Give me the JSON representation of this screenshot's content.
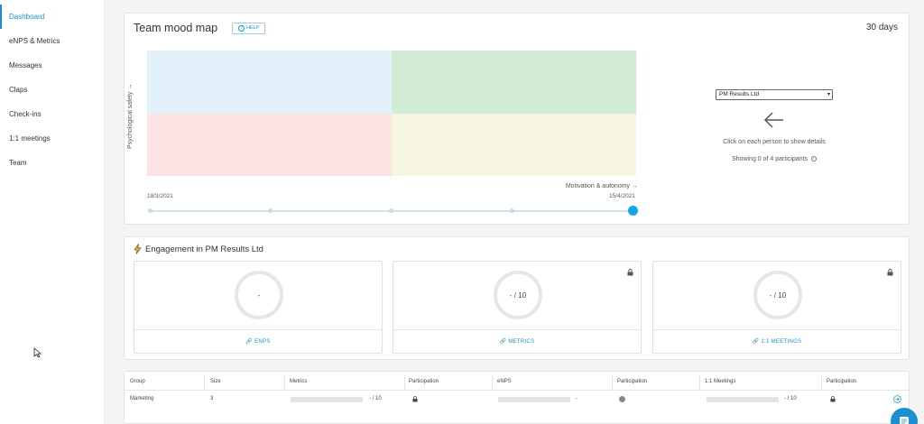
{
  "sidebar": {
    "items": [
      {
        "label": "Dashboard",
        "active": true
      },
      {
        "label": "eNPS & Metrics"
      },
      {
        "label": "Messages"
      },
      {
        "label": "Claps"
      },
      {
        "label": "Check-ins"
      },
      {
        "label": "1:1 meetings"
      },
      {
        "label": "Team"
      }
    ]
  },
  "mood_map": {
    "title": "Team mood map",
    "help_label": "HELP",
    "period": "30 days",
    "y_axis": "Psychological safety →",
    "x_axis": "Motivation & autonomy →",
    "date_start": "18/3/2021",
    "date_end": "15/4/2021",
    "slider": {
      "steps": 5,
      "selected_index": 4
    },
    "quadrant_colors": {
      "top_left": "#e3f1fb",
      "top_right": "#d2ebd4",
      "bottom_left": "#fde3e3",
      "bottom_right": "#f7f6e2"
    },
    "company_select": "PM Results Ltd",
    "hint": "Click on each person to show details",
    "participants_text": "Showing 0 of 4 participants"
  },
  "engagement": {
    "title": "Engagement in PM Results Ltd",
    "cards": [
      {
        "value": "-",
        "link": "ENPS",
        "locked": false
      },
      {
        "value": "- / 10",
        "link": "METRICS",
        "locked": true
      },
      {
        "value": "- / 10",
        "link": "1:1 MEETINGS",
        "locked": true
      }
    ]
  },
  "table": {
    "headers": [
      "Group",
      "Size",
      "Metrics",
      "Participation",
      "eNPS",
      "Participation",
      "1:1 Meetings",
      "Participation"
    ],
    "rows": [
      {
        "group": "Marketing",
        "size": "3",
        "metrics": "- / 10",
        "enps": "-",
        "meetings": "- / 10"
      }
    ]
  },
  "colors": {
    "accent": "#1a8fd6",
    "slider_handle": "#13a7ea"
  }
}
